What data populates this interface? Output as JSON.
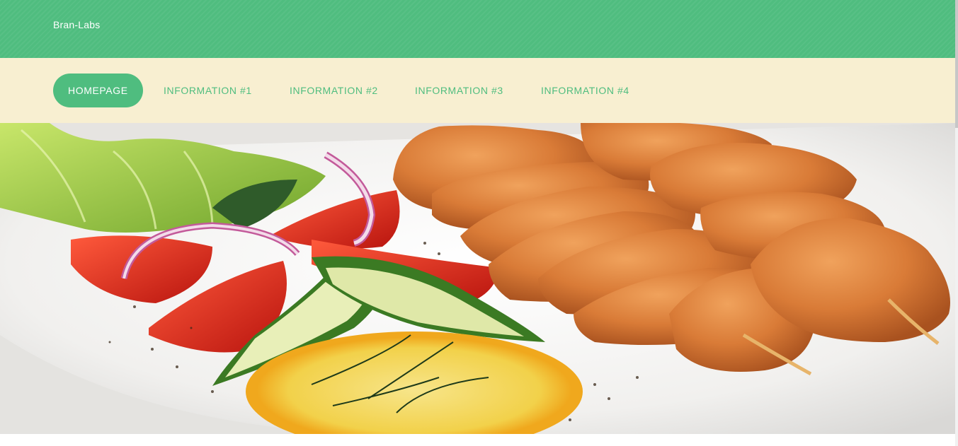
{
  "header": {
    "brand": "Bran-Labs",
    "color": "#4fbd7f"
  },
  "nav": {
    "background": "#f8efd1",
    "items": [
      {
        "label": "HOMEPAGE",
        "active": true
      },
      {
        "label": "INFORMATION #1",
        "active": false
      },
      {
        "label": "INFORMATION #2",
        "active": false
      },
      {
        "label": "INFORMATION #3",
        "active": false
      },
      {
        "label": "INFORMATION #4",
        "active": false
      }
    ]
  },
  "hero": {
    "image": "plate-of-grilled-chicken-skewers-with-salad-image"
  }
}
